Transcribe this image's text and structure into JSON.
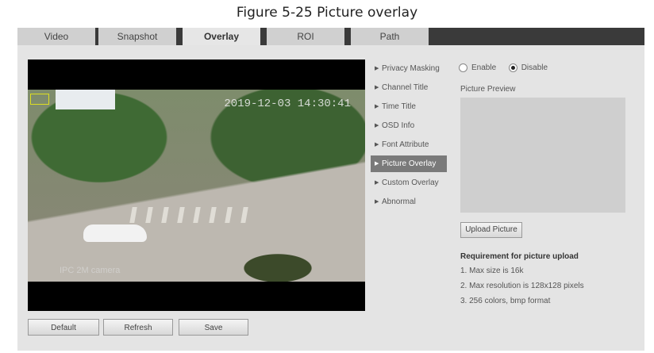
{
  "caption": "Figure 5-25 Picture overlay",
  "tabs": [
    {
      "label": "Video"
    },
    {
      "label": "Snapshot"
    },
    {
      "label": "Overlay",
      "active": true
    },
    {
      "label": "ROI"
    },
    {
      "label": "Path"
    }
  ],
  "video": {
    "timestamp": "2019-12-03 14:30:41",
    "channel_text": "IPC 2M camera"
  },
  "menu": [
    {
      "label": "Privacy Masking"
    },
    {
      "label": "Channel Title"
    },
    {
      "label": "Time Title"
    },
    {
      "label": "OSD Info"
    },
    {
      "label": "Font Attribute"
    },
    {
      "label": "Picture Overlay",
      "active": true
    },
    {
      "label": "Custom Overlay"
    },
    {
      "label": "Abnormal"
    }
  ],
  "settings": {
    "enable_label": "Enable",
    "disable_label": "Disable",
    "selected": "Disable",
    "preview_label": "Picture Preview",
    "upload_label": "Upload Picture",
    "req_title": "Requirement for picture upload",
    "req": [
      "1. Max size is 16k",
      "2. Max resolution is 128x128 pixels",
      "3. 256 colors, bmp format"
    ]
  },
  "buttons": {
    "default": "Default",
    "refresh": "Refresh",
    "save": "Save"
  },
  "colors": {
    "panel": "#e4e4e4",
    "tabbar": "#3a3a3a",
    "active_menu": "#7a7a7a"
  }
}
